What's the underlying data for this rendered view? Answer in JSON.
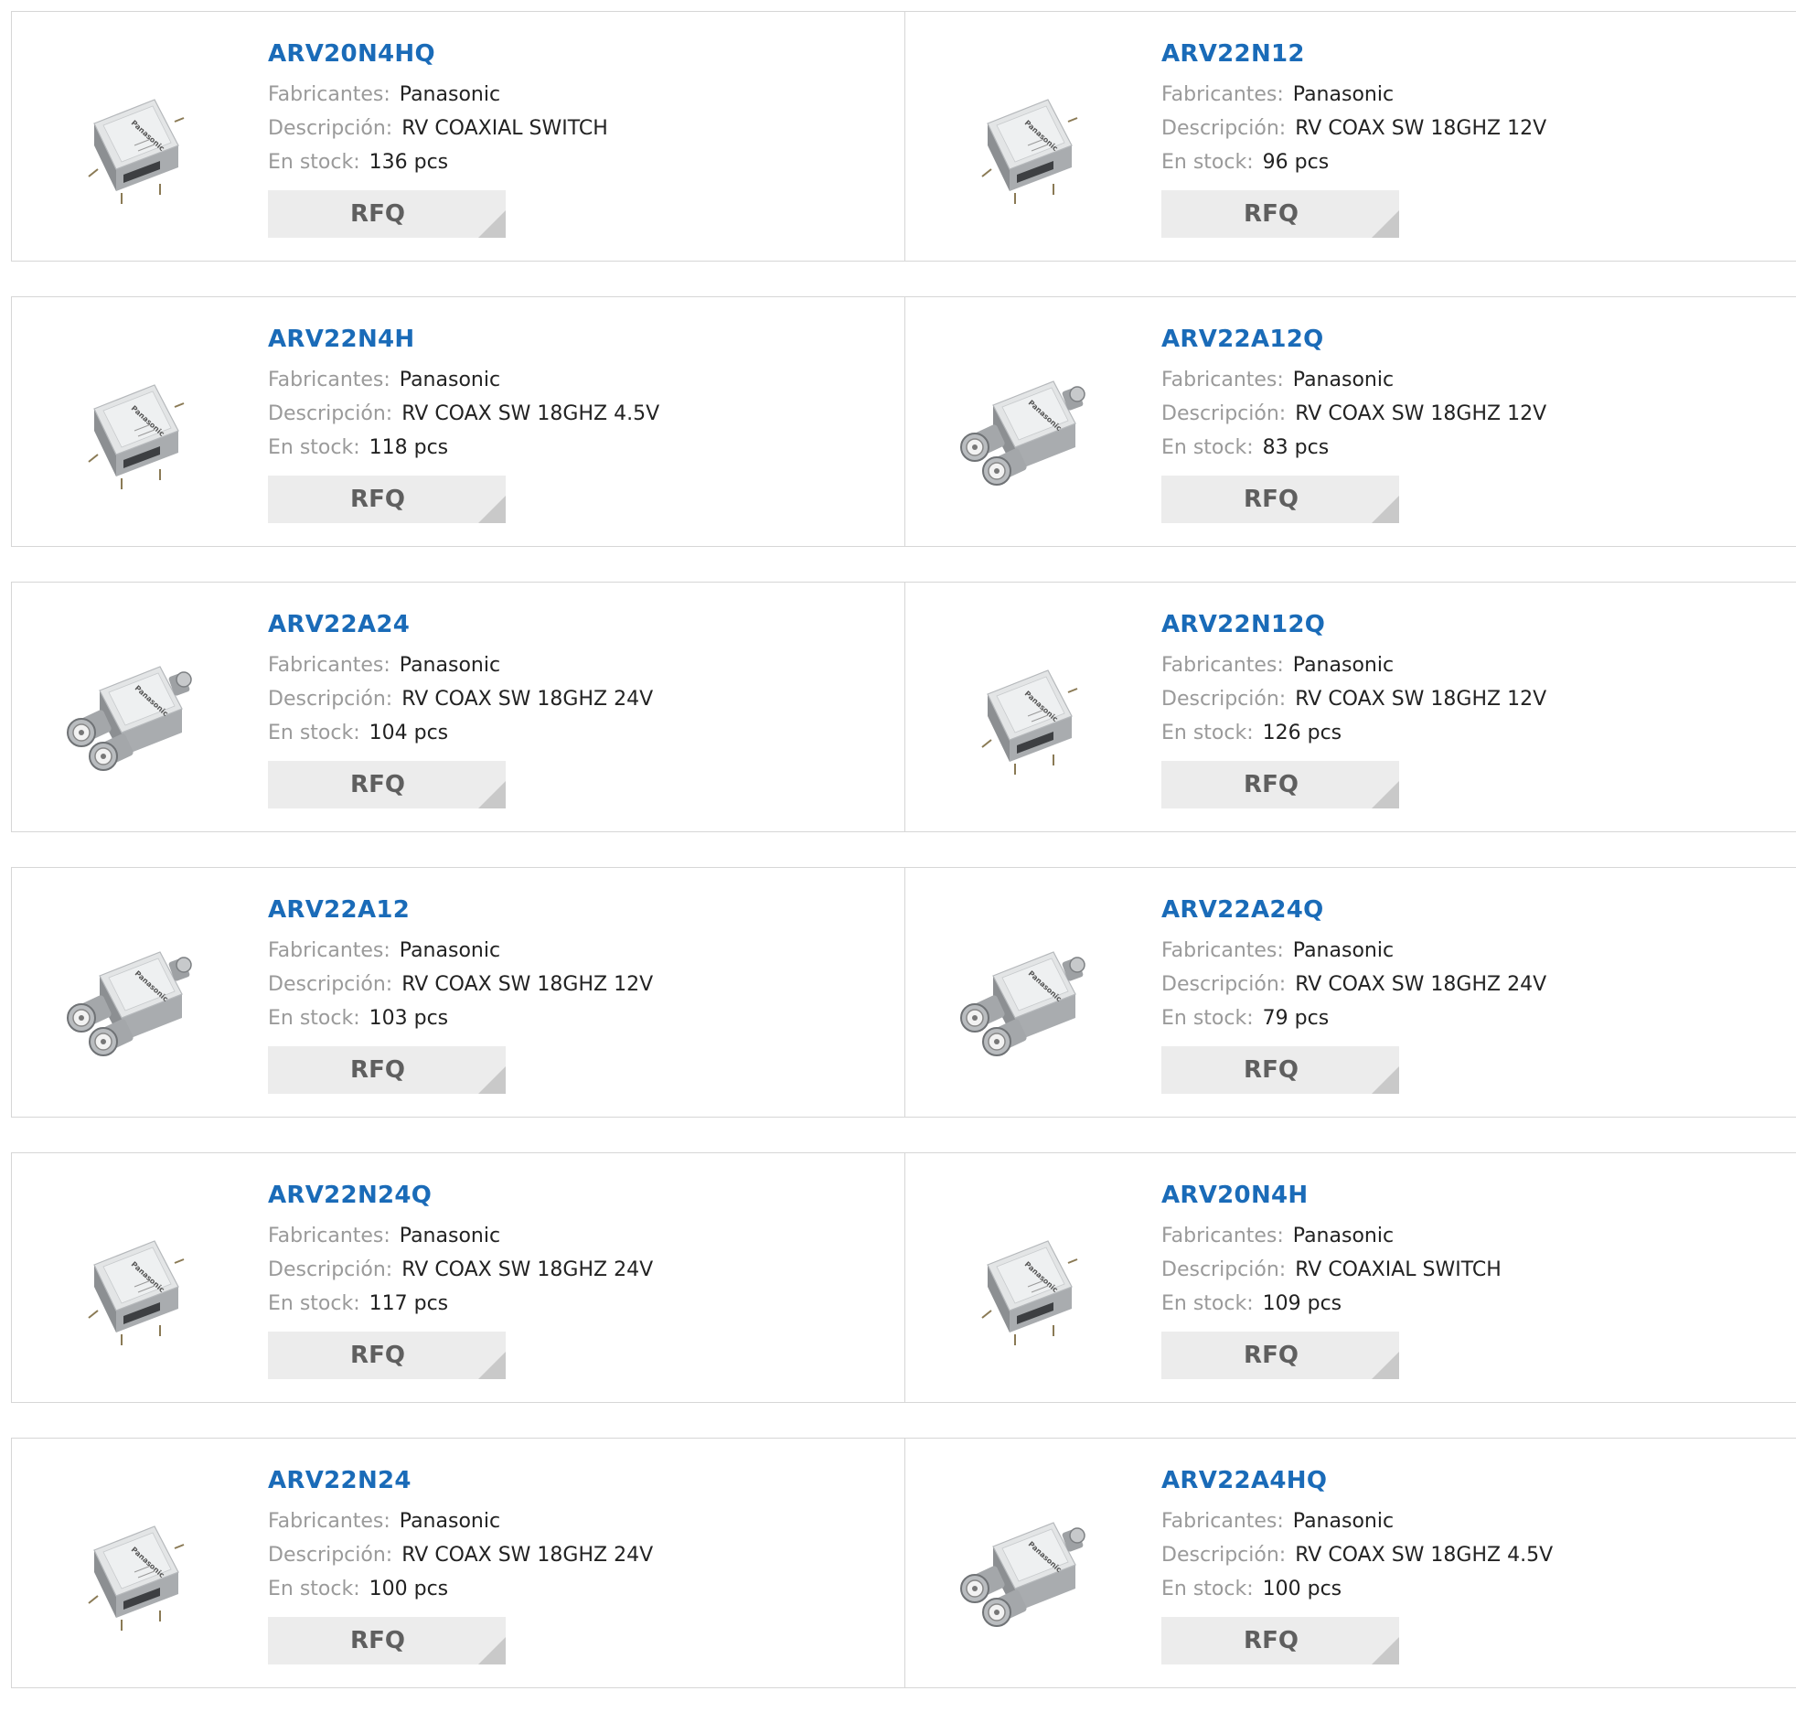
{
  "labels": {
    "manufacturer": "Fabricantes:",
    "description": "Descripción:",
    "stock": "En stock:",
    "rfq": "RFQ"
  },
  "colors": {
    "link": "#1a6bb8",
    "label": "#9a9a9a",
    "value": "#222222",
    "button_bg": "#ececec",
    "button_corner": "#c9c9c9",
    "border": "#d6d6d6"
  },
  "products": [
    {
      "name": "ARV20N4HQ",
      "manufacturer": "Panasonic",
      "description": "RV COAXIAL SWITCH",
      "stock": "136 pcs",
      "image": "coaxial-switch-box-icon"
    },
    {
      "name": "ARV22N12",
      "manufacturer": "Panasonic",
      "description": "RV COAX SW 18GHZ 12V",
      "stock": "96 pcs",
      "image": "coaxial-switch-box-icon"
    },
    {
      "name": "ARV22N4H",
      "manufacturer": "Panasonic",
      "description": "RV COAX SW 18GHZ 4.5V",
      "stock": "118 pcs",
      "image": "coaxial-switch-box-icon"
    },
    {
      "name": "ARV22A12Q",
      "manufacturer": "Panasonic",
      "description": "RV COAX SW 18GHZ 12V",
      "stock": "83 pcs",
      "image": "coaxial-switch-connectors-icon"
    },
    {
      "name": "ARV22A24",
      "manufacturer": "Panasonic",
      "description": "RV COAX SW 18GHZ 24V",
      "stock": "104 pcs",
      "image": "coaxial-switch-connectors-icon"
    },
    {
      "name": "ARV22N12Q",
      "manufacturer": "Panasonic",
      "description": "RV COAX SW 18GHZ 12V",
      "stock": "126 pcs",
      "image": "coaxial-switch-box-icon"
    },
    {
      "name": "ARV22A12",
      "manufacturer": "Panasonic",
      "description": "RV COAX SW 18GHZ 12V",
      "stock": "103 pcs",
      "image": "coaxial-switch-connectors-icon"
    },
    {
      "name": "ARV22A24Q",
      "manufacturer": "Panasonic",
      "description": "RV COAX SW 18GHZ 24V",
      "stock": "79 pcs",
      "image": "coaxial-switch-connectors-icon"
    },
    {
      "name": "ARV22N24Q",
      "manufacturer": "Panasonic",
      "description": "RV COAX SW 18GHZ 24V",
      "stock": "117 pcs",
      "image": "coaxial-switch-box-icon"
    },
    {
      "name": "ARV20N4H",
      "manufacturer": "Panasonic",
      "description": "RV COAXIAL SWITCH",
      "stock": "109 pcs",
      "image": "coaxial-switch-box-icon"
    },
    {
      "name": "ARV22N24",
      "manufacturer": "Panasonic",
      "description": "RV COAX SW 18GHZ 24V",
      "stock": "100 pcs",
      "image": "coaxial-switch-box-icon"
    },
    {
      "name": "ARV22A4HQ",
      "manufacturer": "Panasonic",
      "description": "RV COAX SW 18GHZ 4.5V",
      "stock": "100 pcs",
      "image": "coaxial-switch-connectors-icon"
    }
  ]
}
